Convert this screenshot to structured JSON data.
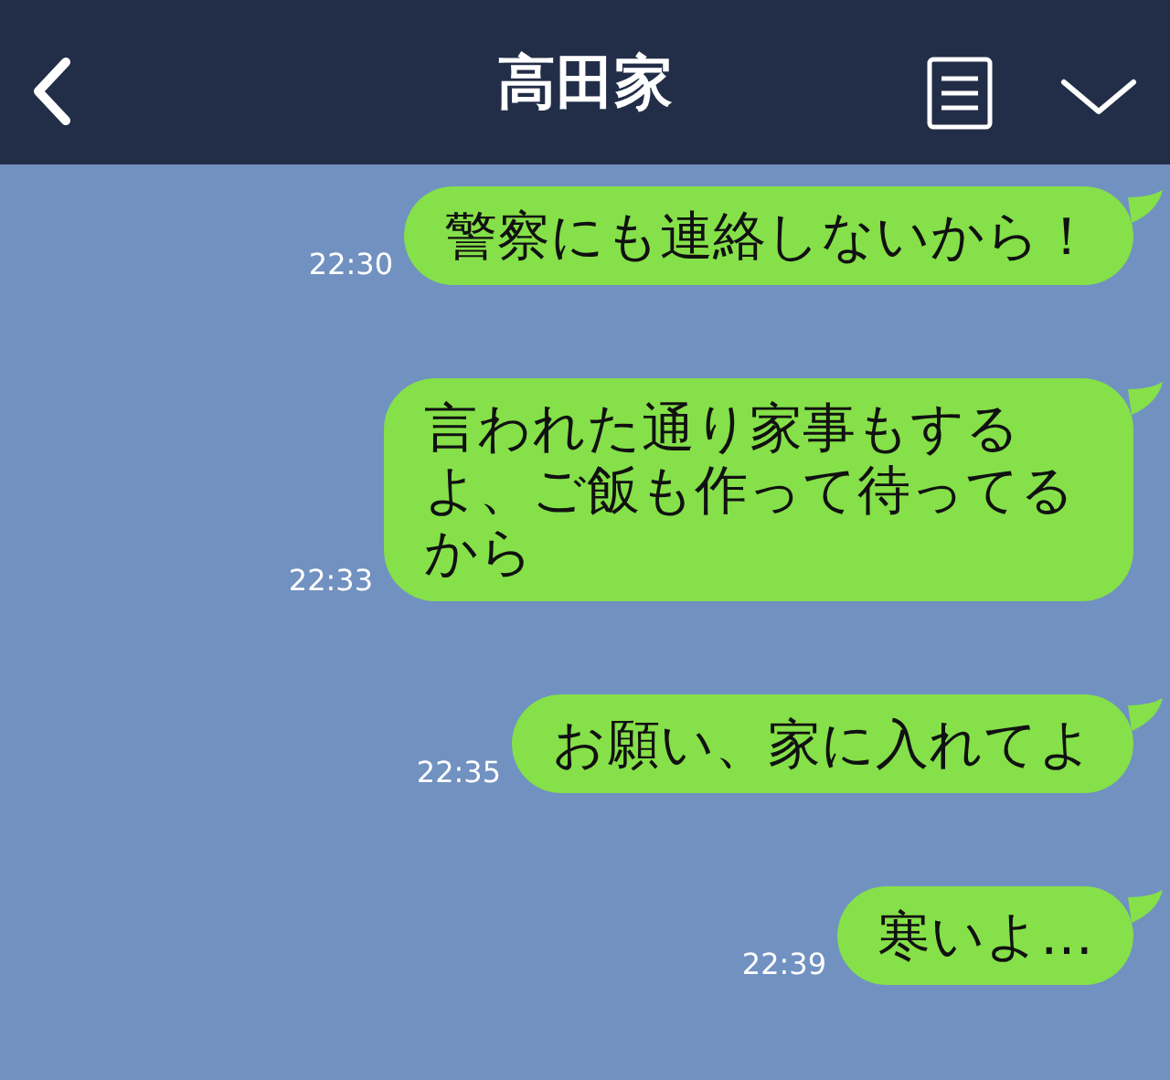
{
  "header": {
    "title": "高田家"
  },
  "messages": [
    {
      "text": "警察にも連絡しないから！",
      "time": "22:30"
    },
    {
      "text": "言われた通り家事もするよ、ご飯も作って待ってるから",
      "time": "22:33"
    },
    {
      "text": "お願い、家に入れてよ",
      "time": "22:35"
    },
    {
      "text": "寒いよ…",
      "time": "22:39"
    }
  ]
}
